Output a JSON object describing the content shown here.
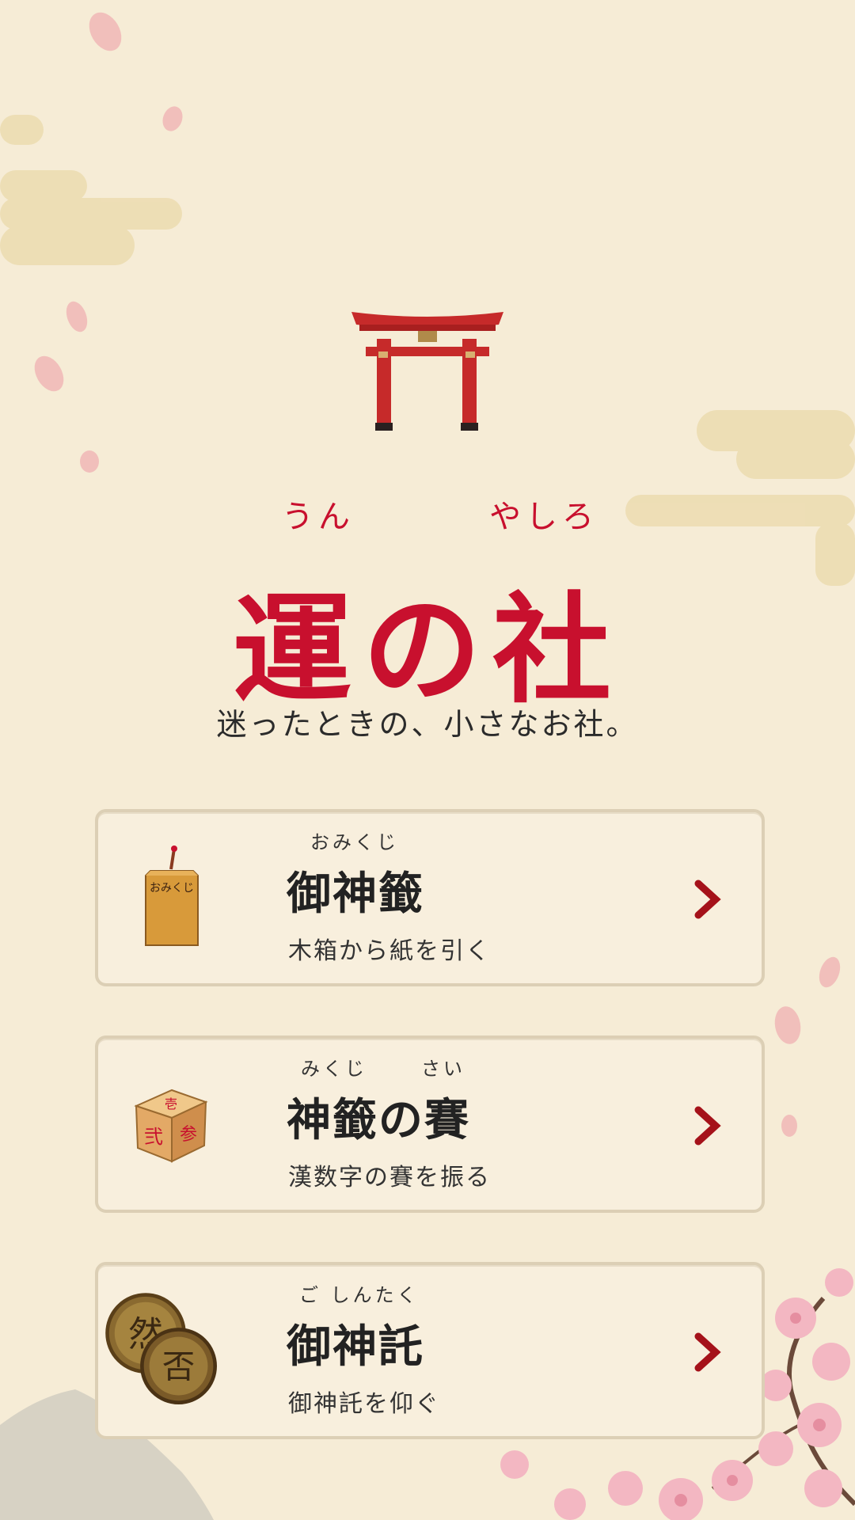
{
  "header": {
    "ruby_left": "うん",
    "ruby_right": "やしろ",
    "title": "運の社",
    "tagline": "迷ったときの、小さなお社。"
  },
  "menu": [
    {
      "ruby_a": "おみくじ",
      "ruby_b": "",
      "title": "御神籤",
      "subtitle": "木箱から紙を引く",
      "icon": "omikuji-box-icon",
      "icon_text": "おみくじ"
    },
    {
      "ruby_a": "みくじ",
      "ruby_b": "さい",
      "title": "神籤の賽",
      "subtitle": "漢数字の賽を振る",
      "icon": "kanji-dice-icon",
      "icon_text": "弐参壱"
    },
    {
      "ruby_a": "ご しんたく",
      "ruby_b": "",
      "title": "御神託",
      "subtitle": "御神託を仰ぐ",
      "icon": "oracle-coins-icon",
      "icon_text": "然否"
    }
  ],
  "colors": {
    "accent": "#c8102e",
    "background": "#f6ecd6",
    "card": "#f8efdd",
    "chevron": "#a5121a"
  }
}
